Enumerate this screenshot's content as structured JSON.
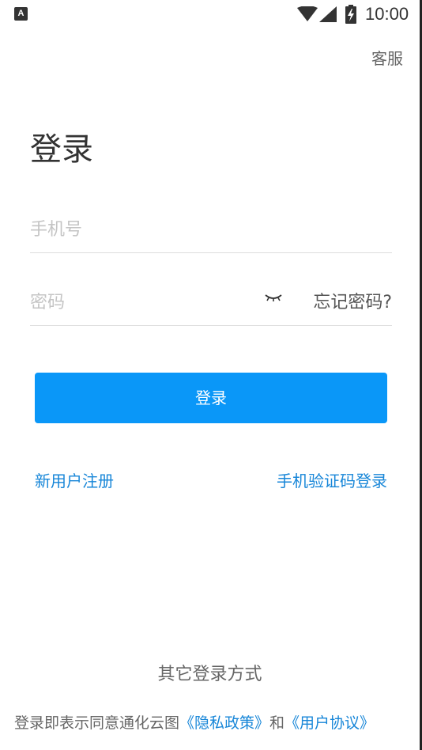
{
  "status_bar": {
    "notification_icon_letter": "A",
    "time": "10:00"
  },
  "header": {
    "service_label": "客服"
  },
  "title": "登录",
  "form": {
    "phone_placeholder": "手机号",
    "password_placeholder": "密码",
    "forgot_label": "忘记密码?",
    "login_button_label": "登录"
  },
  "links": {
    "register": "新用户注册",
    "sms_login": "手机验证码登录"
  },
  "other_methods_label": "其它登录方式",
  "agreement": {
    "prefix": "登录即表示同意通化云图",
    "privacy": "《隐私政策》",
    "and": "和",
    "user_agreement": "《用户协议》"
  },
  "colors": {
    "accent": "#0a97f8",
    "link": "#1786d8"
  },
  "icons": {
    "status": [
      "wifi-icon",
      "signal-icon",
      "battery-charging-icon"
    ],
    "password_toggle": "eye-closed-icon"
  }
}
